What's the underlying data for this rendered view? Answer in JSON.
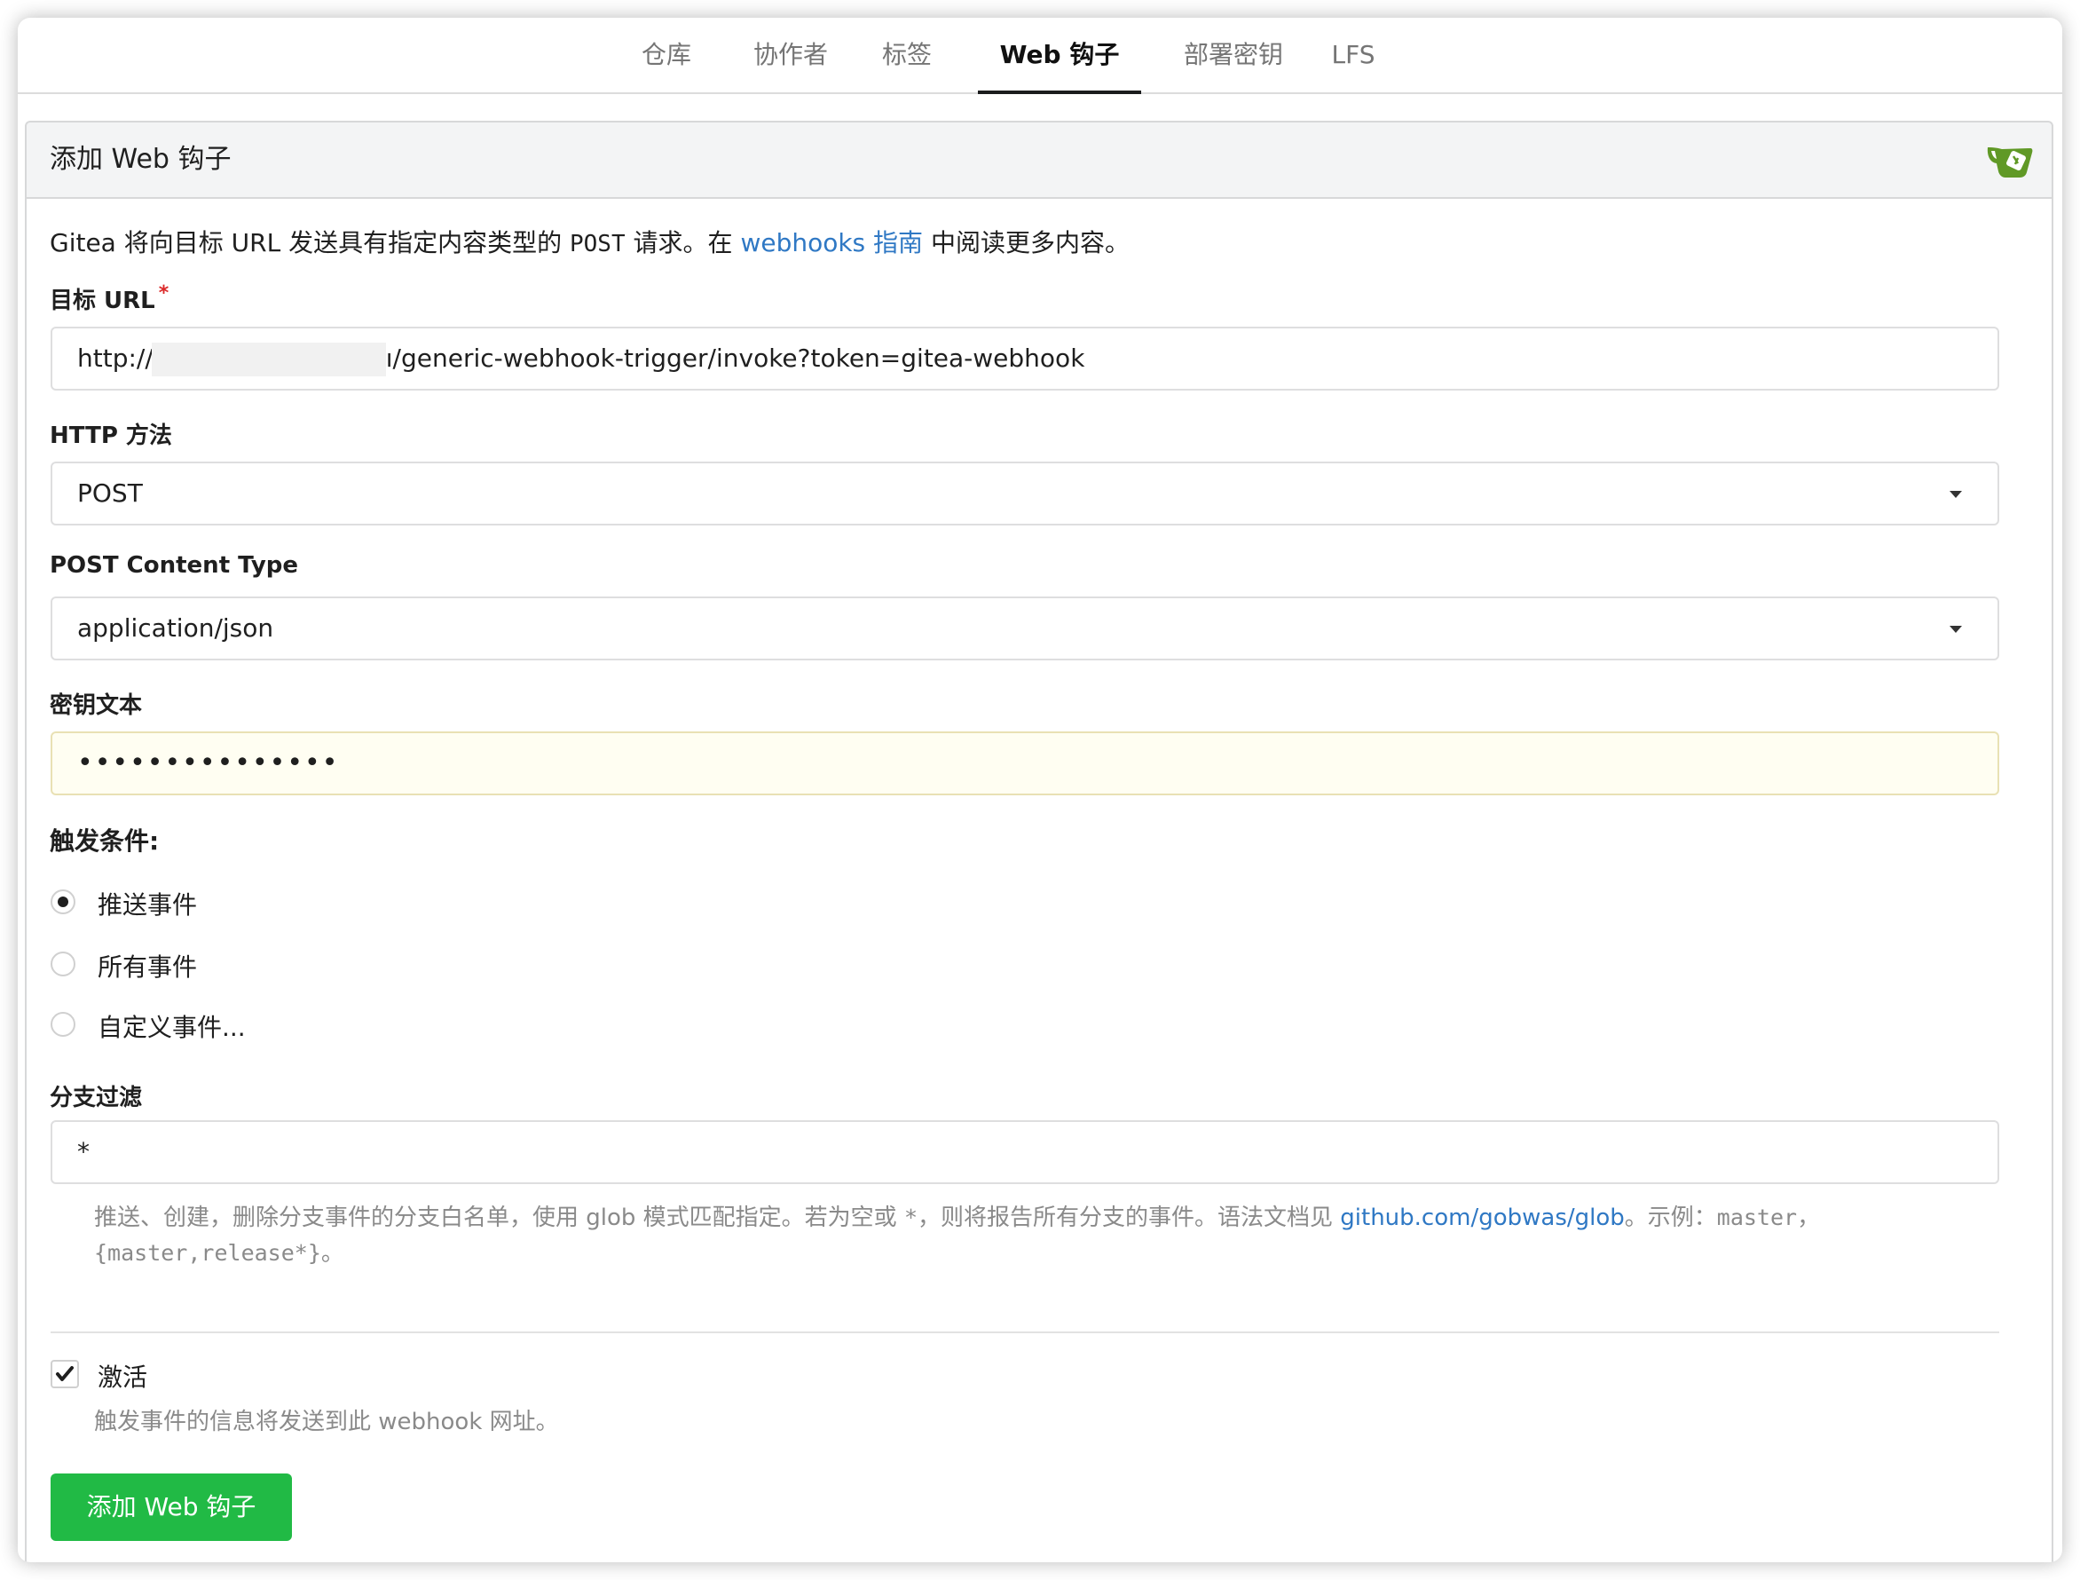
{
  "tabs": [
    {
      "label": "仓库"
    },
    {
      "label": "协作者"
    },
    {
      "label": "标签"
    },
    {
      "label": "Web 钩子"
    },
    {
      "label": "部署密钥"
    },
    {
      "label": "LFS"
    }
  ],
  "active_tab": "Web 钩子",
  "header": {
    "title": "添加 Web 钩子",
    "logo": "gitea-logo-icon"
  },
  "description": {
    "prefix": "Gitea 将向目标 URL 发送具有指定内容类型的 ",
    "method": "POST",
    "middle": " 请求。在 ",
    "link_text": "webhooks 指南",
    "suffix": " 中阅读更多内容。"
  },
  "target_url": {
    "label": "目标 URL",
    "required_mark": "*",
    "value_prefix": "http://",
    "value_suffix": "ı/generic-webhook-trigger/invoke?token=gitea-webhook"
  },
  "http_method": {
    "label": "HTTP 方法",
    "value": "POST"
  },
  "content_type": {
    "label": "POST Content Type",
    "value": "application/json"
  },
  "secret": {
    "label": "密钥文本",
    "value": "•••••••••••••••"
  },
  "trigger": {
    "label": "触发条件:",
    "options": [
      {
        "label": "推送事件",
        "checked": true
      },
      {
        "label": "所有事件",
        "checked": false
      },
      {
        "label": "自定义事件...",
        "checked": false
      }
    ]
  },
  "branch_filter": {
    "label": "分支过滤",
    "value": "*",
    "help_prefix": "推送、创建，删除分支事件的分支白名单，使用 glob 模式匹配指定。若为空或 ",
    "help_star": "*",
    "help_middle": "，则将报告所有分支的事件。语法文档见 ",
    "help_link": "github.com/gobwas/glob",
    "help_after_link": "。示例：",
    "help_example1": "master",
    "help_comma": "，",
    "help_example2": "{master,release*}",
    "help_end": "。"
  },
  "active": {
    "label": "激活",
    "checked": true,
    "help": "触发事件的信息将发送到此 webhook 网址。"
  },
  "submit": {
    "label": "添加 Web 钩子"
  },
  "colors": {
    "accent_green": "#21ba45",
    "link_blue": "#2f78c4",
    "secret_bg": "#fffef2",
    "required_red": "#db2828"
  }
}
